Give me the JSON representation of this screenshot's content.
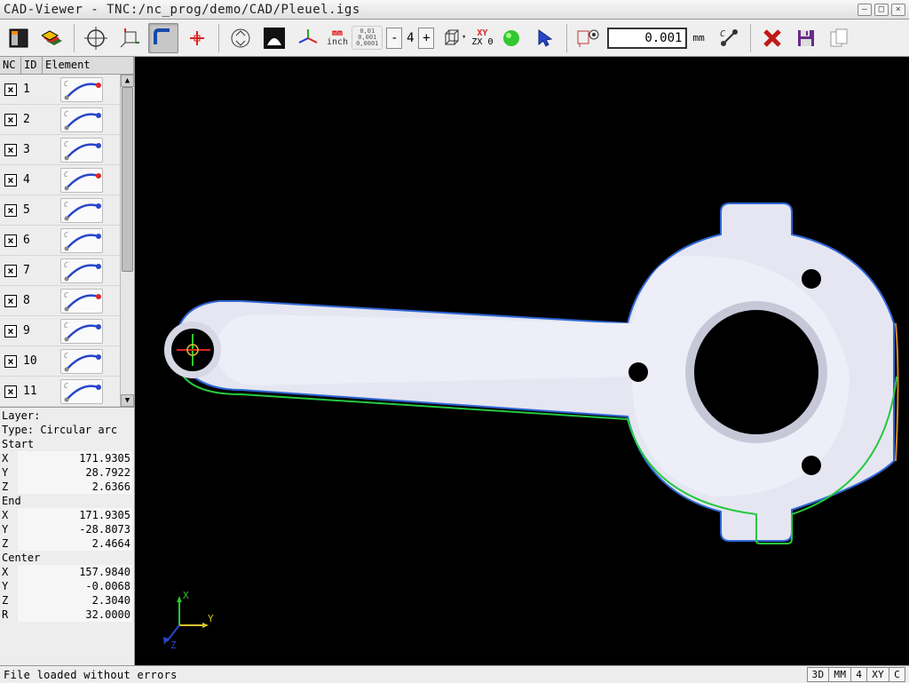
{
  "window": {
    "title": "CAD-Viewer - TNC:/nc_prog/demo/CAD/Pleuel.igs"
  },
  "toolbar": {
    "decimals": {
      "labels": [
        "0,01",
        "0,001",
        "0,0001"
      ]
    },
    "step_val": "4",
    "readout": "0.001",
    "unit": "mm",
    "mm_label": "mm",
    "inch_label": "inch",
    "xy_label": "XY",
    "zx_label": "ZX Θ"
  },
  "sidebar": {
    "headers": {
      "nc": "NC",
      "id": "ID",
      "el": "Element"
    },
    "rows": [
      {
        "check": "×",
        "id": "1"
      },
      {
        "check": "×",
        "id": "2"
      },
      {
        "check": "×",
        "id": "3"
      },
      {
        "check": "×",
        "id": "4"
      },
      {
        "check": "×",
        "id": "5"
      },
      {
        "check": "×",
        "id": "6"
      },
      {
        "check": "×",
        "id": "7"
      },
      {
        "check": "×",
        "id": "8"
      },
      {
        "check": "×",
        "id": "9"
      },
      {
        "check": "×",
        "id": "10"
      },
      {
        "check": "×",
        "id": "11"
      }
    ]
  },
  "props": {
    "layer_label": "Layer:",
    "type_label": "Type:",
    "type_value": "Circular arc",
    "start_label": "Start",
    "end_label": "End",
    "center_label": "Center",
    "start": {
      "x": "171.9305",
      "y": "28.7922",
      "z": "2.6366"
    },
    "end": {
      "x": "171.9305",
      "y": "-28.8073",
      "z": "2.4664"
    },
    "center": {
      "x": "157.9840",
      "y": "-0.0068",
      "z": "2.3040",
      "r": "32.0000"
    },
    "lbl": {
      "X": "X",
      "Y": "Y",
      "Z": "Z",
      "R": "R"
    }
  },
  "status": {
    "message": "File loaded without errors",
    "badges": [
      "3D",
      "MM",
      "4",
      "XY",
      "C"
    ]
  },
  "axis": {
    "x": "X",
    "y": "Y",
    "z": "Z"
  }
}
